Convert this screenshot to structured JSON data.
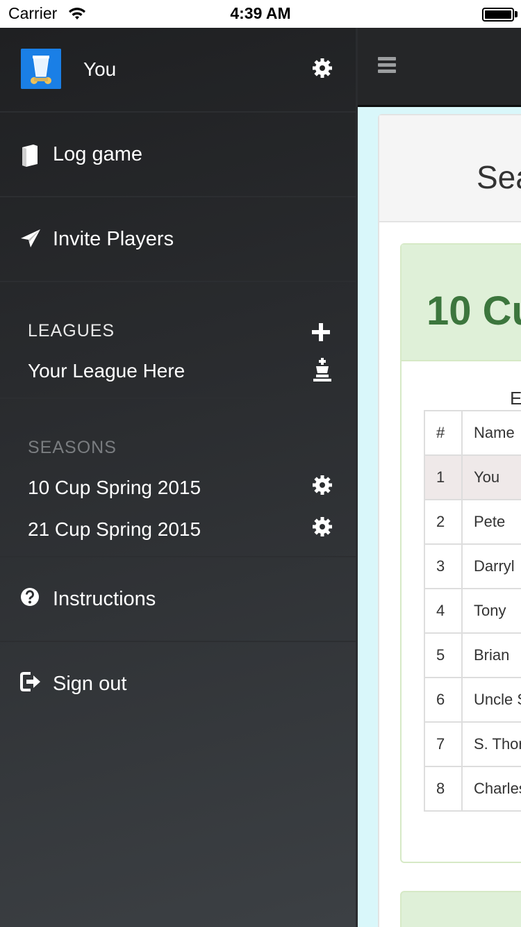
{
  "status_bar": {
    "carrier": "Carrier",
    "time": "4:39 AM"
  },
  "drawer": {
    "profile": {
      "name": "You"
    },
    "nav": {
      "log_game": "Log game",
      "invite_players": "Invite Players",
      "instructions": "Instructions",
      "sign_out": "Sign out"
    },
    "leagues": {
      "header": "LEAGUES",
      "items": [
        {
          "label": "Your League Here"
        }
      ]
    },
    "seasons": {
      "header": "SEASONS",
      "items": [
        {
          "label": "10 Cup Spring 2015"
        },
        {
          "label": "21 Cup Spring 2015"
        }
      ]
    }
  },
  "main": {
    "panel_title": "Sea",
    "season_card": {
      "title": "10 Cu",
      "caption": "E",
      "columns": [
        "#",
        "Name"
      ],
      "rows": [
        {
          "rank": "1",
          "name": "You"
        },
        {
          "rank": "2",
          "name": "Pete"
        },
        {
          "rank": "3",
          "name": "Darryl"
        },
        {
          "rank": "4",
          "name": "Tony"
        },
        {
          "rank": "5",
          "name": "Brian"
        },
        {
          "rank": "6",
          "name": "Uncle S"
        },
        {
          "rank": "7",
          "name": "S. Thor"
        },
        {
          "rank": "8",
          "name": "Charles"
        }
      ]
    }
  },
  "colors": {
    "drawer_bg": "#2a2c2f",
    "accent_green": "#3c763d",
    "card_head_green": "#dff0d8",
    "content_bg": "#d9f7fa"
  },
  "icons": [
    "wifi-icon",
    "battery-icon",
    "avatar-cup-icon",
    "gear-icon",
    "book-icon",
    "paper-plane-icon",
    "plus-icon",
    "chess-king-icon",
    "question-circle-icon",
    "sign-out-icon",
    "hamburger-menu-icon"
  ]
}
